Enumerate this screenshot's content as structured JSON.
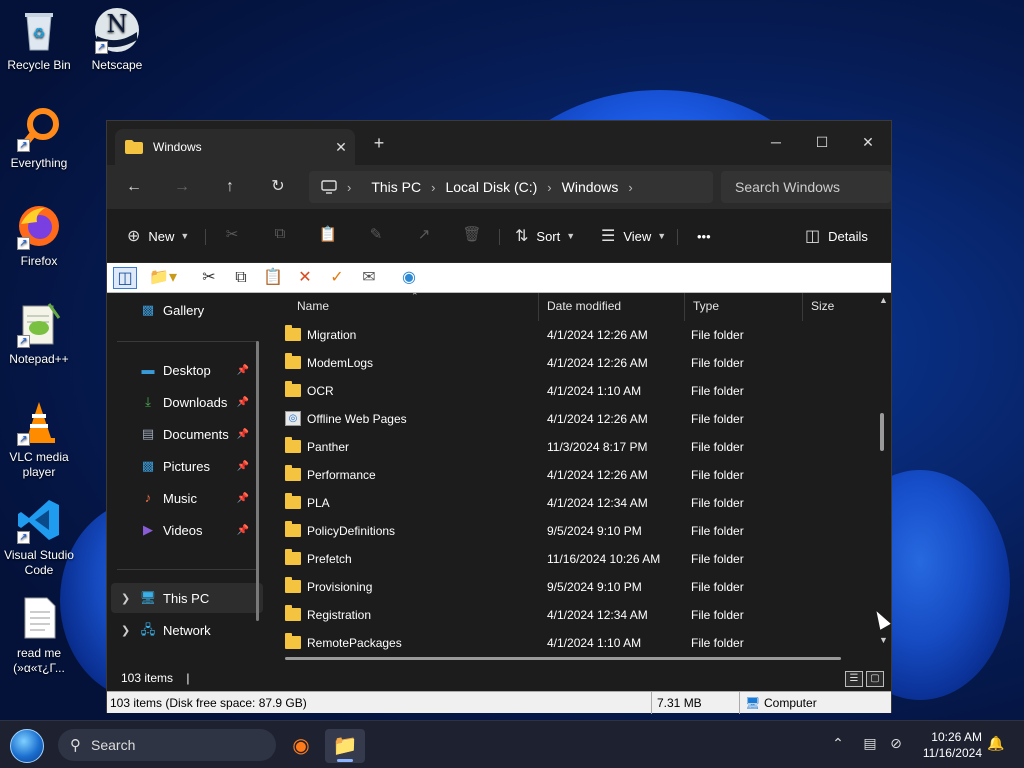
{
  "desktop": {
    "icons": [
      {
        "label": "Recycle Bin",
        "icon": "recycle-bin-icon",
        "shortcut": false
      },
      {
        "label": "Netscape",
        "icon": "netscape-icon",
        "shortcut": true
      },
      {
        "label": "Everything",
        "icon": "everything-search-icon",
        "shortcut": true
      },
      {
        "label": "Firefox",
        "icon": "firefox-icon",
        "shortcut": true
      },
      {
        "label": "Notepad++",
        "icon": "notepad-plus-plus-icon",
        "shortcut": true
      },
      {
        "label": "VLC media player",
        "icon": "vlc-icon",
        "shortcut": true
      },
      {
        "label": "Visual Studio Code",
        "icon": "vscode-icon",
        "shortcut": true
      },
      {
        "label": "read me (»α«τ¿Γ...",
        "icon": "text-document-icon",
        "shortcut": false
      }
    ]
  },
  "window": {
    "tab_title": "Windows",
    "new_tab": "+",
    "controls": {
      "minimize": "─",
      "maximize": "☐",
      "close": "✕"
    },
    "nav": {
      "back": "←",
      "forward": "→",
      "up": "↑",
      "refresh": "↻",
      "breadcrumbs": [
        "This PC",
        "Local Disk (C:)",
        "Windows"
      ],
      "search_placeholder": "Search Windows"
    },
    "commands": {
      "new": "New",
      "sort": "Sort",
      "view": "View",
      "more": "•••",
      "details": "Details"
    },
    "nav_pane": {
      "gallery": "Gallery",
      "quick_access": [
        {
          "label": "Desktop",
          "icon": "desktop-folder-icon",
          "color": "#3a9ad9"
        },
        {
          "label": "Downloads",
          "icon": "download-arrow-icon",
          "color": "#4caf50"
        },
        {
          "label": "Documents",
          "icon": "documents-icon",
          "color": "#9aa6b8"
        },
        {
          "label": "Pictures",
          "icon": "pictures-icon",
          "color": "#3a9ad9"
        },
        {
          "label": "Music",
          "icon": "music-icon",
          "color": "#e8704a"
        },
        {
          "label": "Videos",
          "icon": "videos-icon",
          "color": "#8a5cd6"
        }
      ],
      "this_pc": "This PC",
      "network": "Network"
    },
    "columns": {
      "name": "Name",
      "date": "Date modified",
      "type": "Type",
      "size": "Size"
    },
    "files": [
      {
        "name": "Migration",
        "date": "4/1/2024 12:26 AM",
        "type": "File folder",
        "special": false
      },
      {
        "name": "ModemLogs",
        "date": "4/1/2024 12:26 AM",
        "type": "File folder",
        "special": false
      },
      {
        "name": "OCR",
        "date": "4/1/2024 1:10 AM",
        "type": "File folder",
        "special": false
      },
      {
        "name": "Offline Web Pages",
        "date": "4/1/2024 12:26 AM",
        "type": "File folder",
        "special": true
      },
      {
        "name": "Panther",
        "date": "11/3/2024 8:17 PM",
        "type": "File folder",
        "special": false
      },
      {
        "name": "Performance",
        "date": "4/1/2024 12:26 AM",
        "type": "File folder",
        "special": false
      },
      {
        "name": "PLA",
        "date": "4/1/2024 12:34 AM",
        "type": "File folder",
        "special": false
      },
      {
        "name": "PolicyDefinitions",
        "date": "9/5/2024 9:10 PM",
        "type": "File folder",
        "special": false
      },
      {
        "name": "Prefetch",
        "date": "11/16/2024 10:26 AM",
        "type": "File folder",
        "special": false
      },
      {
        "name": "Provisioning",
        "date": "9/5/2024 9:10 PM",
        "type": "File folder",
        "special": false
      },
      {
        "name": "Registration",
        "date": "4/1/2024 12:34 AM",
        "type": "File folder",
        "special": false
      },
      {
        "name": "RemotePackages",
        "date": "4/1/2024 1:10 AM",
        "type": "File folder",
        "special": false
      }
    ],
    "status": {
      "item_count": "103 items",
      "divider": "|"
    },
    "classic_status": {
      "left": "103 items (Disk free space: 87.9 GB)",
      "size": "7.31 MB",
      "zone": "Computer"
    }
  },
  "taskbar": {
    "search_label": "Search",
    "time": "10:26 AM",
    "date": "11/16/2024"
  }
}
